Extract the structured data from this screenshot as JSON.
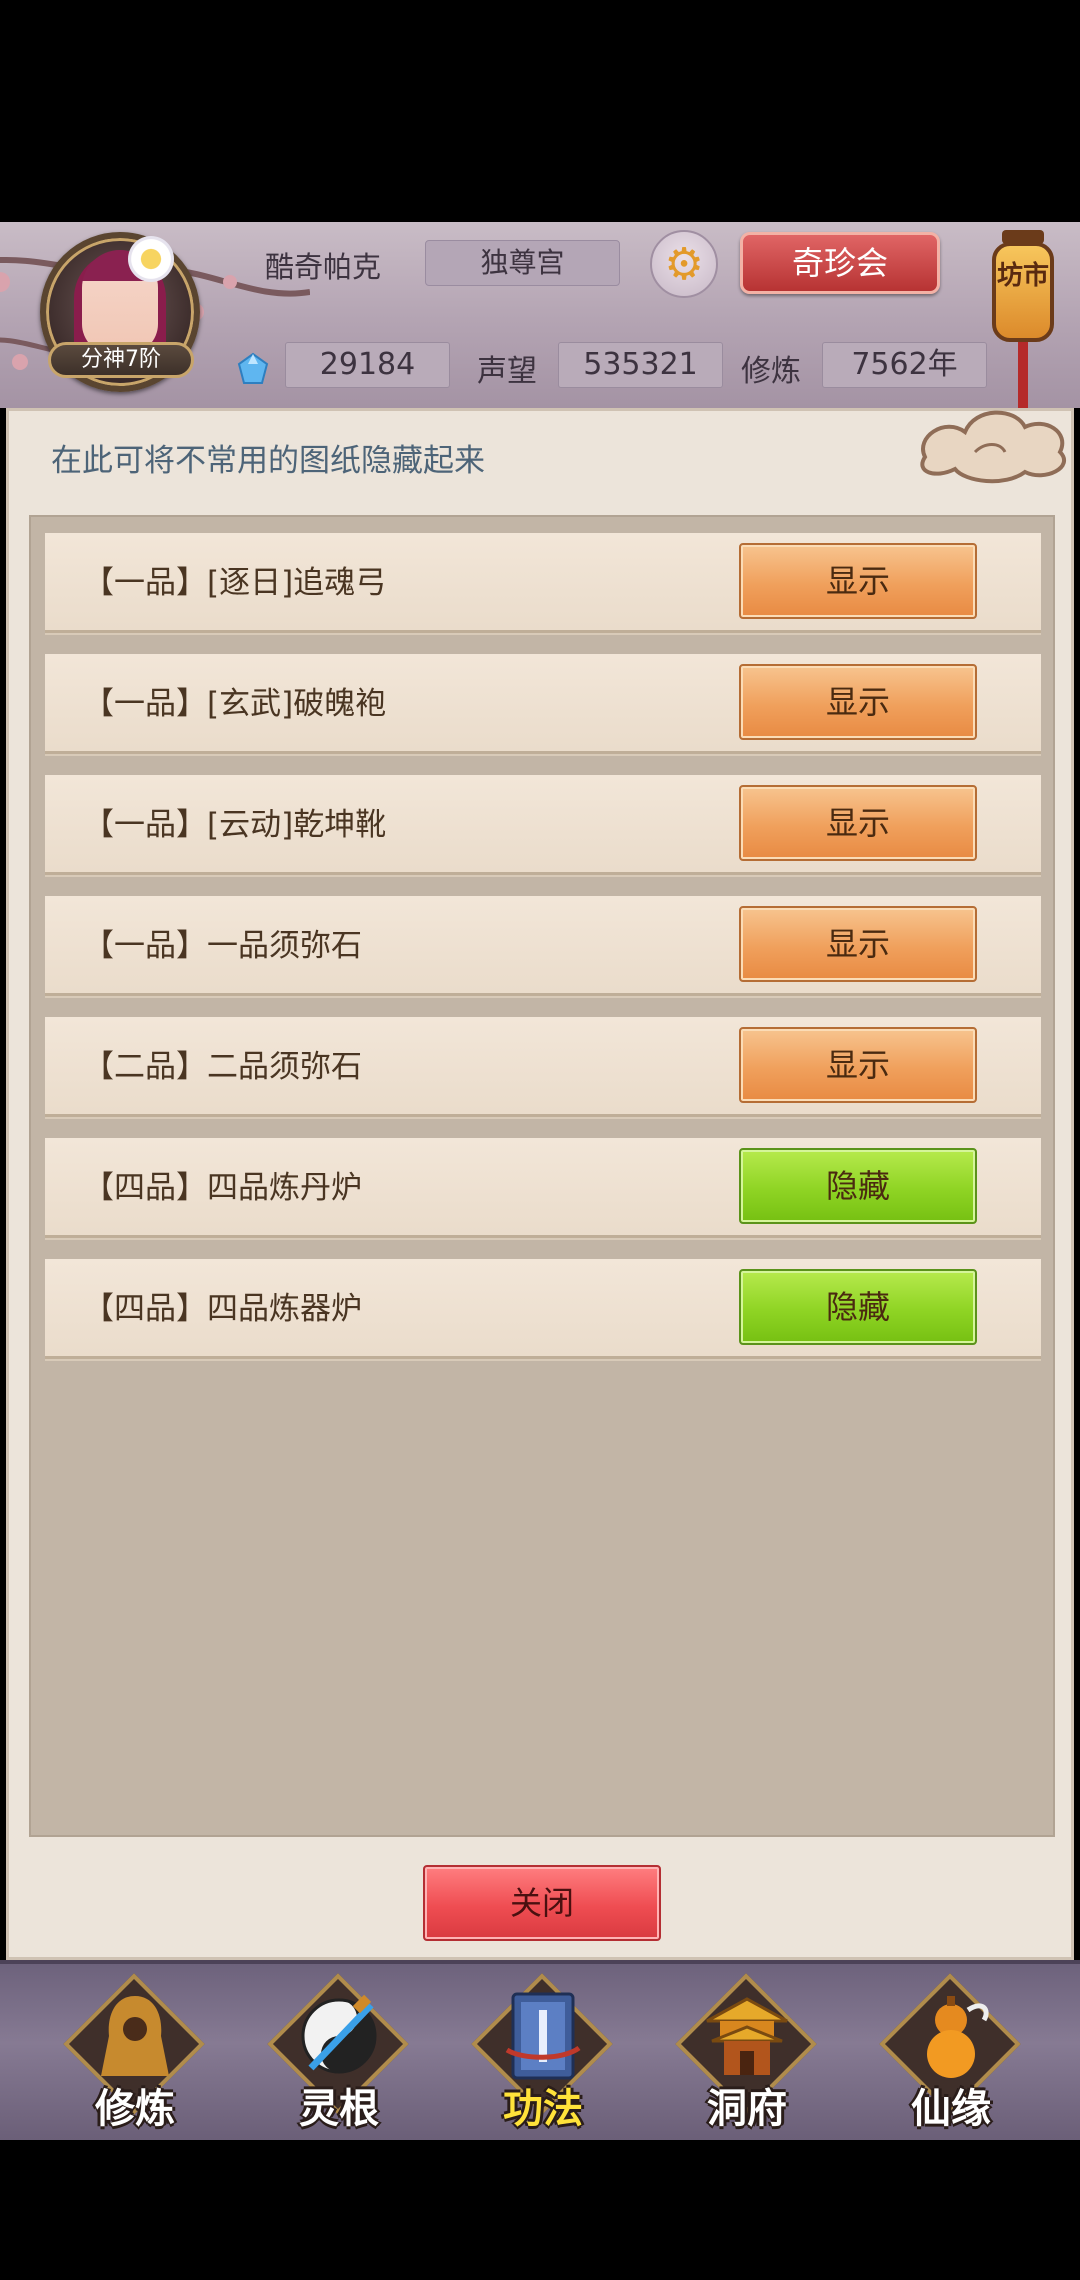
{
  "header": {
    "player_name": "酷奇帕克",
    "rank": "分神7阶",
    "guild": "独尊宫",
    "treasure_button": "奇珍会",
    "market_sign": "坊市",
    "gems": "29184",
    "reputation_label": "声望",
    "reputation": "535321",
    "cultivation_label": "修炼",
    "cultivation": "7562年"
  },
  "panel": {
    "hint": "在此可将不常用的图纸隐藏起来",
    "close_label": "关闭",
    "rows": [
      {
        "label": "【一品】[逐日]追魂弓",
        "button": "显示",
        "state": "show"
      },
      {
        "label": "【一品】[玄武]破魄袍",
        "button": "显示",
        "state": "show"
      },
      {
        "label": "【一品】[云动]乾坤靴",
        "button": "显示",
        "state": "show"
      },
      {
        "label": "【一品】一品须弥石",
        "button": "显示",
        "state": "show"
      },
      {
        "label": "【二品】二品须弥石",
        "button": "显示",
        "state": "show"
      },
      {
        "label": "【四品】四品炼丹炉",
        "button": "隐藏",
        "state": "hide"
      },
      {
        "label": "【四品】四品炼器炉",
        "button": "隐藏",
        "state": "hide"
      }
    ]
  },
  "nav": {
    "items": [
      {
        "label": "修炼",
        "icon": "monk-icon",
        "active": false
      },
      {
        "label": "灵根",
        "icon": "yin-yang-sword-icon",
        "active": false
      },
      {
        "label": "功法",
        "icon": "book-icon",
        "active": true
      },
      {
        "label": "洞府",
        "icon": "pavilion-icon",
        "active": false
      },
      {
        "label": "仙缘",
        "icon": "gourd-icon",
        "active": false
      }
    ]
  },
  "colors": {
    "show_button": "#f0a05c",
    "hide_button": "#8fd424",
    "close_button": "#ef4d52",
    "treasure_button": "#c94444",
    "hint_text": "#4d6478"
  }
}
